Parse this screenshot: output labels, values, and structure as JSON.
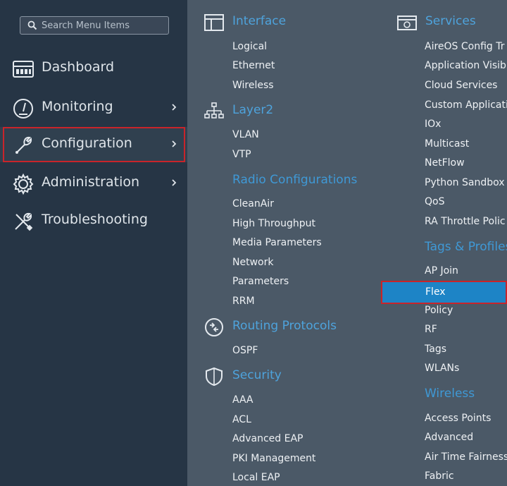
{
  "search": {
    "placeholder": "Search Menu Items"
  },
  "sidebar": {
    "items": [
      {
        "label": "Dashboard",
        "icon": "dashboard-icon"
      },
      {
        "label": "Monitoring",
        "icon": "gauge-icon"
      },
      {
        "label": "Configuration",
        "icon": "wrench-icon"
      },
      {
        "label": "Administration",
        "icon": "gear-icon"
      },
      {
        "label": "Troubleshooting",
        "icon": "tools-icon"
      }
    ]
  },
  "menu": {
    "interface": {
      "title": "Interface",
      "items": [
        "Logical",
        "Ethernet",
        "Wireless"
      ]
    },
    "layer2": {
      "title": "Layer2",
      "items": [
        "VLAN",
        "VTP"
      ]
    },
    "radio": {
      "title": "Radio Configurations",
      "items": [
        "CleanAir",
        "High Throughput",
        "Media Parameters",
        "Network",
        "Parameters",
        "RRM"
      ]
    },
    "routing": {
      "title": "Routing Protocols",
      "items": [
        "OSPF"
      ]
    },
    "security": {
      "title": "Security",
      "items": [
        "AAA",
        "ACL",
        "Advanced EAP",
        "PKI Management",
        "Local EAP"
      ]
    },
    "services": {
      "title": "Services",
      "items": [
        "AireOS Config Tr",
        "Application Visibi",
        "Cloud Services",
        "Custom Applicati",
        "IOx",
        "Multicast",
        "NetFlow",
        "Python Sandbox",
        "QoS",
        "RA Throttle Polic"
      ]
    },
    "tags": {
      "title": "Tags & Profiles",
      "items": [
        "AP Join",
        "Flex",
        "Policy",
        "RF",
        "Tags",
        "WLANs"
      ]
    },
    "wireless": {
      "title": "Wireless",
      "items": [
        "Access Points",
        "Advanced",
        "Air Time Fairness",
        "Fabric"
      ]
    }
  },
  "colors": {
    "highlight": "#1d84c6",
    "section": "#4ea3dc",
    "outline": "#c9242a"
  }
}
